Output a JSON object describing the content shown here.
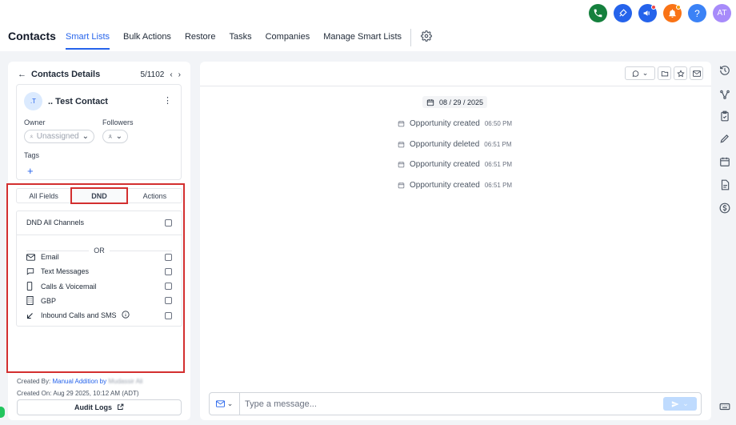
{
  "header": {
    "title": "Contacts",
    "tabs": [
      {
        "label": "Smart Lists",
        "active": true
      },
      {
        "label": "Bulk Actions"
      },
      {
        "label": "Restore"
      },
      {
        "label": "Tasks"
      },
      {
        "label": "Companies"
      },
      {
        "label": "Manage Smart Lists"
      }
    ],
    "top_icons": [
      {
        "name": "phone-icon",
        "color": "#15803d"
      },
      {
        "name": "rocket-icon",
        "color": "#2563eb"
      },
      {
        "name": "megaphone-icon",
        "color": "#2563eb"
      },
      {
        "name": "bell-icon",
        "color": "#f97316"
      },
      {
        "name": "help-icon",
        "color": "#3b82f6",
        "glyph": "?"
      }
    ],
    "avatar": {
      "initials": "AT",
      "color": "#a78bfa"
    }
  },
  "contact_panel": {
    "header_title": "Contacts Details",
    "position": "5/1102",
    "contact": {
      "avatar_initials": ".T",
      "name": ".. Test Contact"
    },
    "owner_label": "Owner",
    "owner_value": "Unassigned",
    "followers_label": "Followers",
    "tags_label": "Tags",
    "tabs": [
      {
        "label": "All Fields"
      },
      {
        "label": "DND",
        "active": true
      },
      {
        "label": "Actions"
      }
    ],
    "dnd_all_label": "DND All Channels",
    "or_label": "OR",
    "channels": [
      {
        "label": "Email",
        "icon": "mail-icon"
      },
      {
        "label": "Text Messages",
        "icon": "chat-icon"
      },
      {
        "label": "Calls & Voicemail",
        "icon": "phone-device-icon"
      },
      {
        "label": "GBP",
        "icon": "building-icon"
      },
      {
        "label": "Inbound Calls and SMS",
        "icon": "arrow-down-left-icon"
      }
    ],
    "created_by_label": "Created By:",
    "created_by_value": "Manual Addition by",
    "created_by_user": "Mudassir Ali",
    "created_on": "Created On: Aug 29 2025, 10:12 AM (ADT)",
    "audit_logs_label": "Audit Logs"
  },
  "conversation": {
    "date": "08 / 29 / 2025",
    "activities": [
      {
        "text": "Opportunity created",
        "time": "06:50 PM"
      },
      {
        "text": "Opportunity deleted",
        "time": "06:51 PM"
      },
      {
        "text": "Opportunity created",
        "time": "06:51 PM"
      },
      {
        "text": "Opportunity created",
        "time": "06:51 PM"
      }
    ],
    "composer_placeholder": "Type a message..."
  }
}
